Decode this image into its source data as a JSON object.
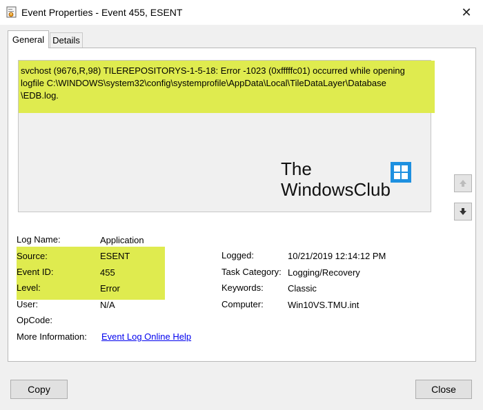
{
  "window": {
    "title": "Event Properties - Event 455, ESENT",
    "close_glyph": "✕"
  },
  "tabs": [
    {
      "label": "General"
    },
    {
      "label": "Details"
    }
  ],
  "description": {
    "line1": "svchost (9676,R,98) TILEREPOSITORYS-1-5-18: Error -1023 (0xfffffc01) occurred while opening",
    "line2": "logfile C:\\WINDOWS\\system32\\config\\systemprofile\\AppData\\Local\\TileDataLayer\\Database",
    "line3": "\\EDB.log.",
    "watermark_line1": "The",
    "watermark_line2": "WindowsClub"
  },
  "fields": {
    "log_name": {
      "label": "Log Name:",
      "value": "Application"
    },
    "source": {
      "label": "Source:",
      "value": "ESENT"
    },
    "event_id": {
      "label": "Event ID:",
      "value": "455"
    },
    "level": {
      "label": "Level:",
      "value": "Error"
    },
    "user": {
      "label": "User:",
      "value": "N/A"
    },
    "opcode": {
      "label": "OpCode:",
      "value": ""
    },
    "more_info": {
      "label": "More Information:",
      "link": "Event Log Online Help"
    },
    "logged": {
      "label": "Logged:",
      "value": "10/21/2019 12:14:12 PM"
    },
    "task_category": {
      "label": "Task Category:",
      "value": "Logging/Recovery"
    },
    "keywords": {
      "label": "Keywords:",
      "value": "Classic"
    },
    "computer": {
      "label": "Computer:",
      "value": "Win10VS.TMU.int"
    }
  },
  "buttons": {
    "copy": "Copy",
    "close": "Close"
  },
  "colors": {
    "highlight": "#dfeb4f",
    "link": "#0000ee",
    "windows_logo": "#1e90e0"
  },
  "icons": {
    "app": "event-viewer-icon",
    "up": "arrow-up-icon",
    "down": "arrow-down-icon"
  }
}
